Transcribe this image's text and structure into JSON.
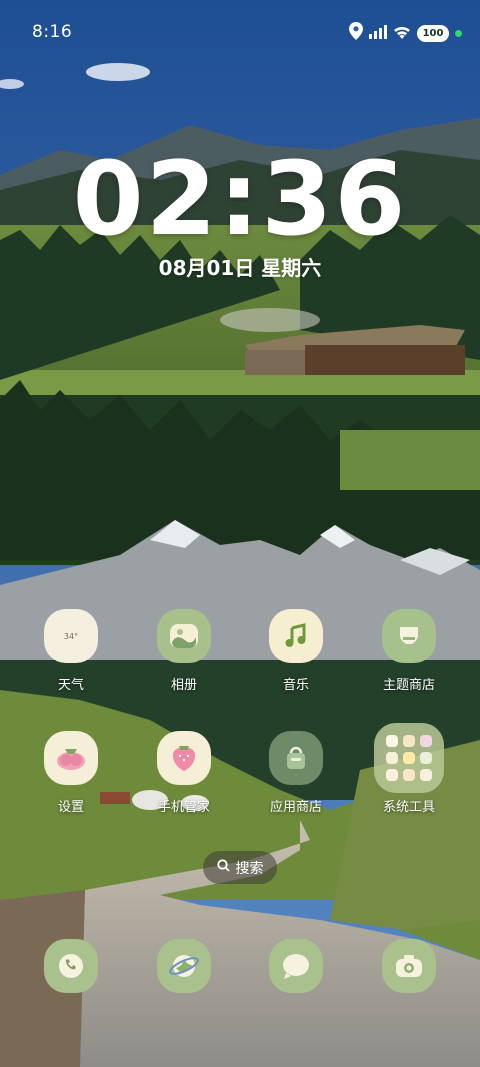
{
  "status_bar": {
    "time": "8:16",
    "battery": "100",
    "icons": [
      "location-icon",
      "signal-icon",
      "wifi-icon",
      "battery-icon",
      "charging-dot"
    ]
  },
  "lock_clock": {
    "time": "02:36",
    "date": "08月01日 星期六"
  },
  "apps_row1": [
    {
      "label": "天气",
      "icon": "weather-icon",
      "text": "34°"
    },
    {
      "label": "相册",
      "icon": "gallery-icon"
    },
    {
      "label": "音乐",
      "icon": "music-icon"
    },
    {
      "label": "主题商店",
      "icon": "theme-store-icon"
    }
  ],
  "apps_row2": [
    {
      "label": "设置",
      "icon": "settings-icon"
    },
    {
      "label": "手机管家",
      "icon": "phone-manager-icon"
    },
    {
      "label": "应用商店",
      "icon": "app-store-icon"
    },
    {
      "label": "系统工具",
      "icon": "system-tools-folder-icon"
    }
  ],
  "search": {
    "label": "搜索"
  },
  "dock": [
    "phone-icon",
    "browser-icon",
    "messages-icon",
    "camera-icon"
  ],
  "colors": {
    "icon_green": "#a9c38e",
    "icon_cream": "#f5efd6",
    "icon_dark_green": "#6f8a61",
    "sky": "#2f63a9"
  }
}
